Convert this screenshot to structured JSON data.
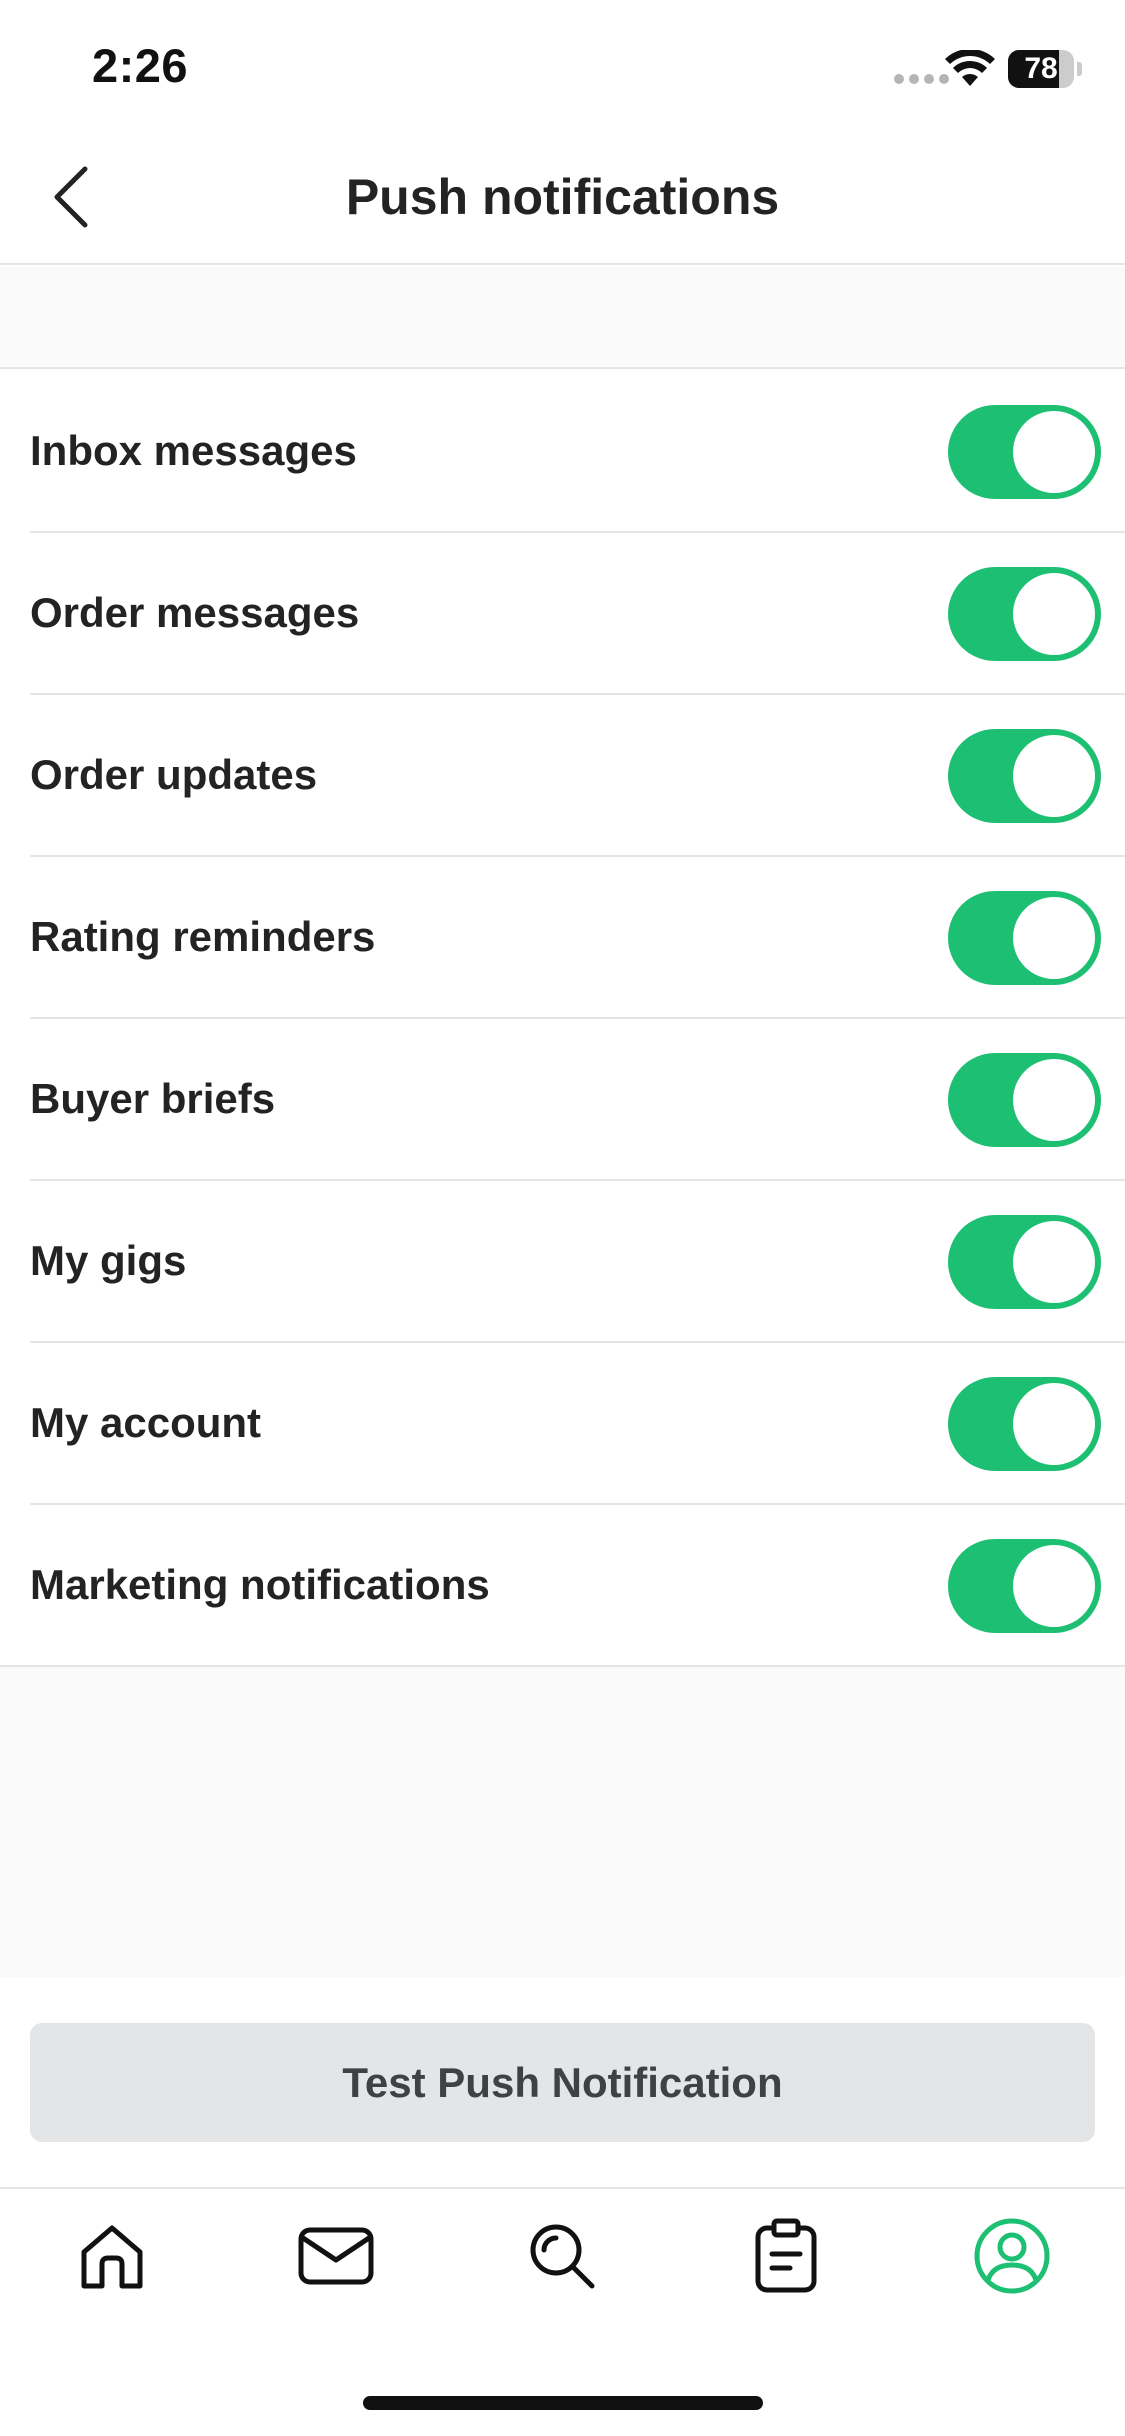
{
  "status_bar": {
    "time": "2:26",
    "battery_level": "78"
  },
  "header": {
    "title": "Push notifications",
    "back_icon": "chevron-left-icon"
  },
  "settings": [
    {
      "label": "Inbox messages",
      "enabled": true
    },
    {
      "label": "Order messages",
      "enabled": true
    },
    {
      "label": "Order updates",
      "enabled": true
    },
    {
      "label": "Rating reminders",
      "enabled": true
    },
    {
      "label": "Buyer briefs",
      "enabled": true
    },
    {
      "label": "My gigs",
      "enabled": true
    },
    {
      "label": "My account",
      "enabled": true
    },
    {
      "label": "Marketing notifications",
      "enabled": true
    }
  ],
  "test_button": {
    "label": "Test Push Notification"
  },
  "tab_bar": {
    "items": [
      {
        "icon": "home-icon",
        "active": false
      },
      {
        "icon": "mail-icon",
        "active": false
      },
      {
        "icon": "search-icon",
        "active": false
      },
      {
        "icon": "orders-clipboard-icon",
        "active": false
      },
      {
        "icon": "profile-icon",
        "active": true
      }
    ]
  },
  "colors": {
    "accent": "#1dbf73",
    "text": "#222325",
    "divider": "#e4e5e7",
    "button_bg": "#e4e5e7"
  }
}
